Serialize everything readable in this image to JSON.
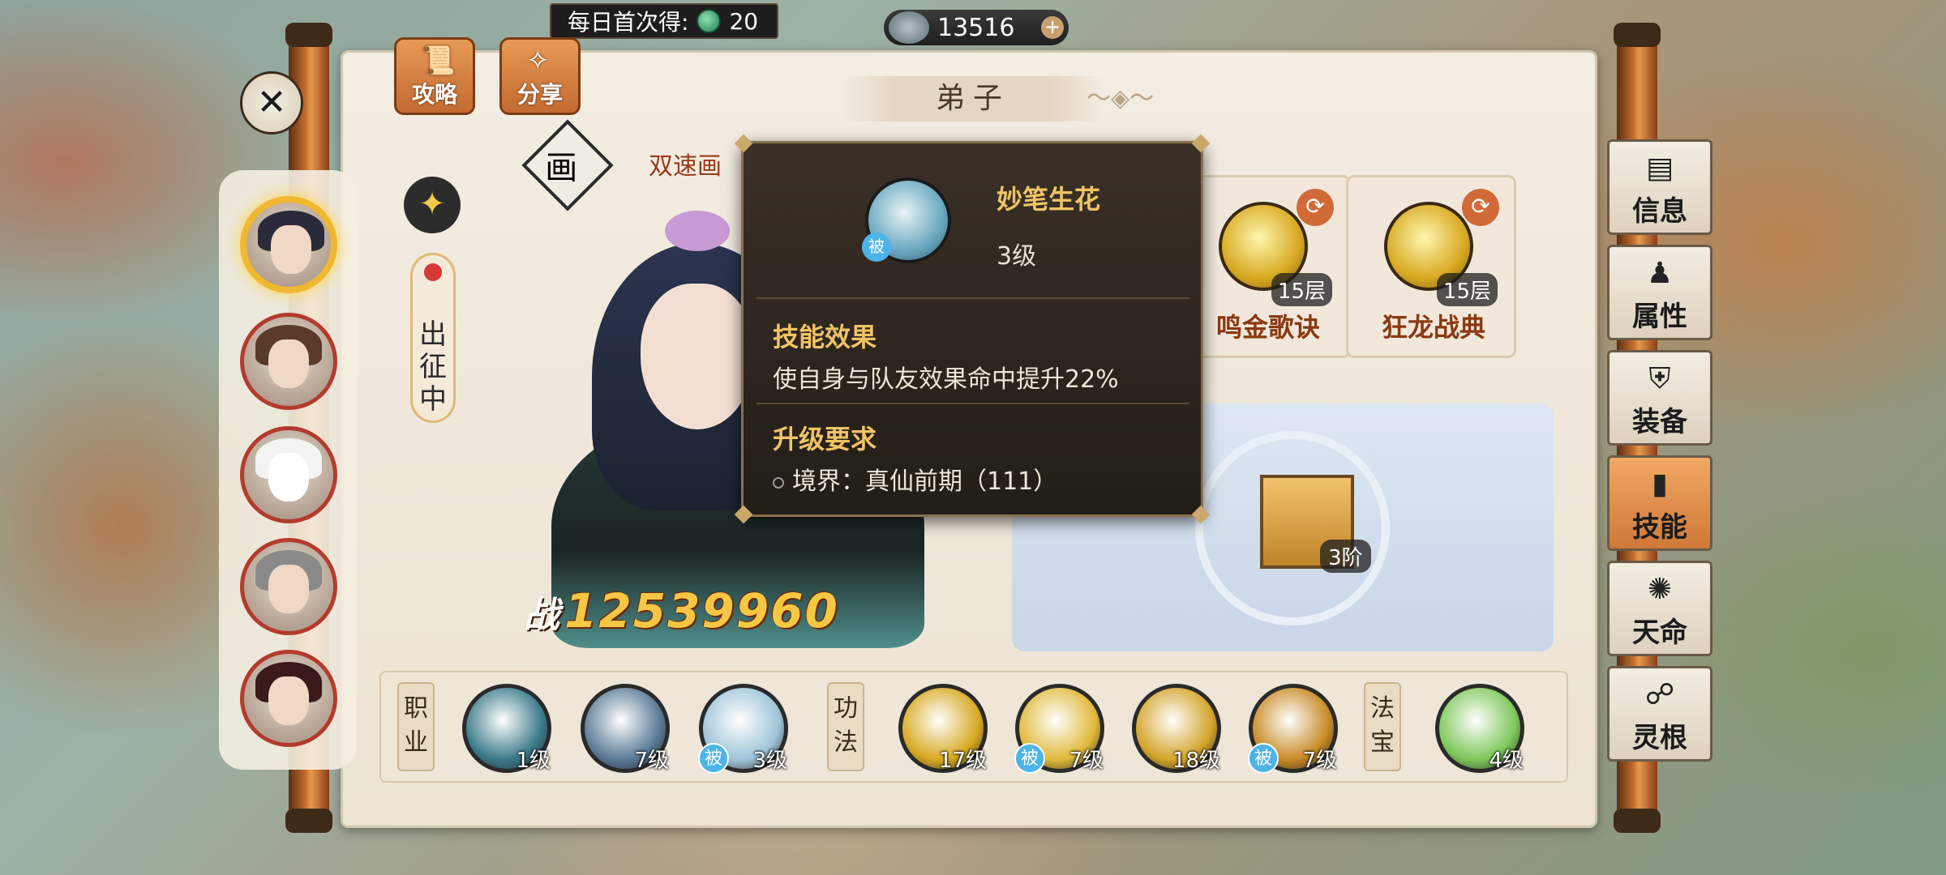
{
  "top": {
    "daily_label": "每日首次得:",
    "daily_value": "20",
    "currency_value": "13516",
    "currency_plus": "+"
  },
  "header": {
    "title": "弟子",
    "btn_guide": "攻略",
    "btn_share": "分享",
    "class_char": "画",
    "subtitle": "双速画"
  },
  "left": {
    "status": "出征中",
    "type_icon": "✦"
  },
  "character": {
    "power_prefix": "战",
    "power_value": "12539960"
  },
  "skill_cards": [
    {
      "name": "鸣金歌诀",
      "layers": "15层"
    },
    {
      "name": "狂龙战典",
      "layers": "15层"
    }
  ],
  "treasure": {
    "tier": "3阶"
  },
  "skillbar": {
    "cat_class": "职业",
    "cat_art": "功法",
    "cat_treasure": "法宝",
    "passive_mark": "被",
    "skills": [
      {
        "level": "1级",
        "color": "#3b7a8a",
        "passive": false
      },
      {
        "level": "7级",
        "color": "#5a7a96",
        "passive": false
      },
      {
        "level": "3级",
        "color": "#9fc4d8",
        "passive": true
      },
      {
        "level": "17级",
        "color": "#d8a921",
        "passive": false
      },
      {
        "level": "7级",
        "color": "#e0b93a",
        "passive": true
      },
      {
        "level": "18级",
        "color": "#d4a42a",
        "passive": false
      },
      {
        "level": "7级",
        "color": "#c88a26",
        "passive": true
      },
      {
        "level": "4级",
        "color": "#7ec85a",
        "passive": false
      }
    ]
  },
  "tabs": [
    {
      "label": "信息",
      "icon": "▤"
    },
    {
      "label": "属性",
      "icon": "♟"
    },
    {
      "label": "装备",
      "icon": "⛨"
    },
    {
      "label": "技能",
      "icon": "▮"
    },
    {
      "label": "天命",
      "icon": "✺"
    },
    {
      "label": "灵根",
      "icon": "☍"
    }
  ],
  "tooltip": {
    "name": "妙笔生花",
    "level": "3级",
    "passive_mark": "被",
    "effect_heading": "技能效果",
    "effect_text": "使自身与队友效果命中提升22%",
    "req_heading": "升级要求",
    "req_text": "境界：真仙前期（111）"
  }
}
